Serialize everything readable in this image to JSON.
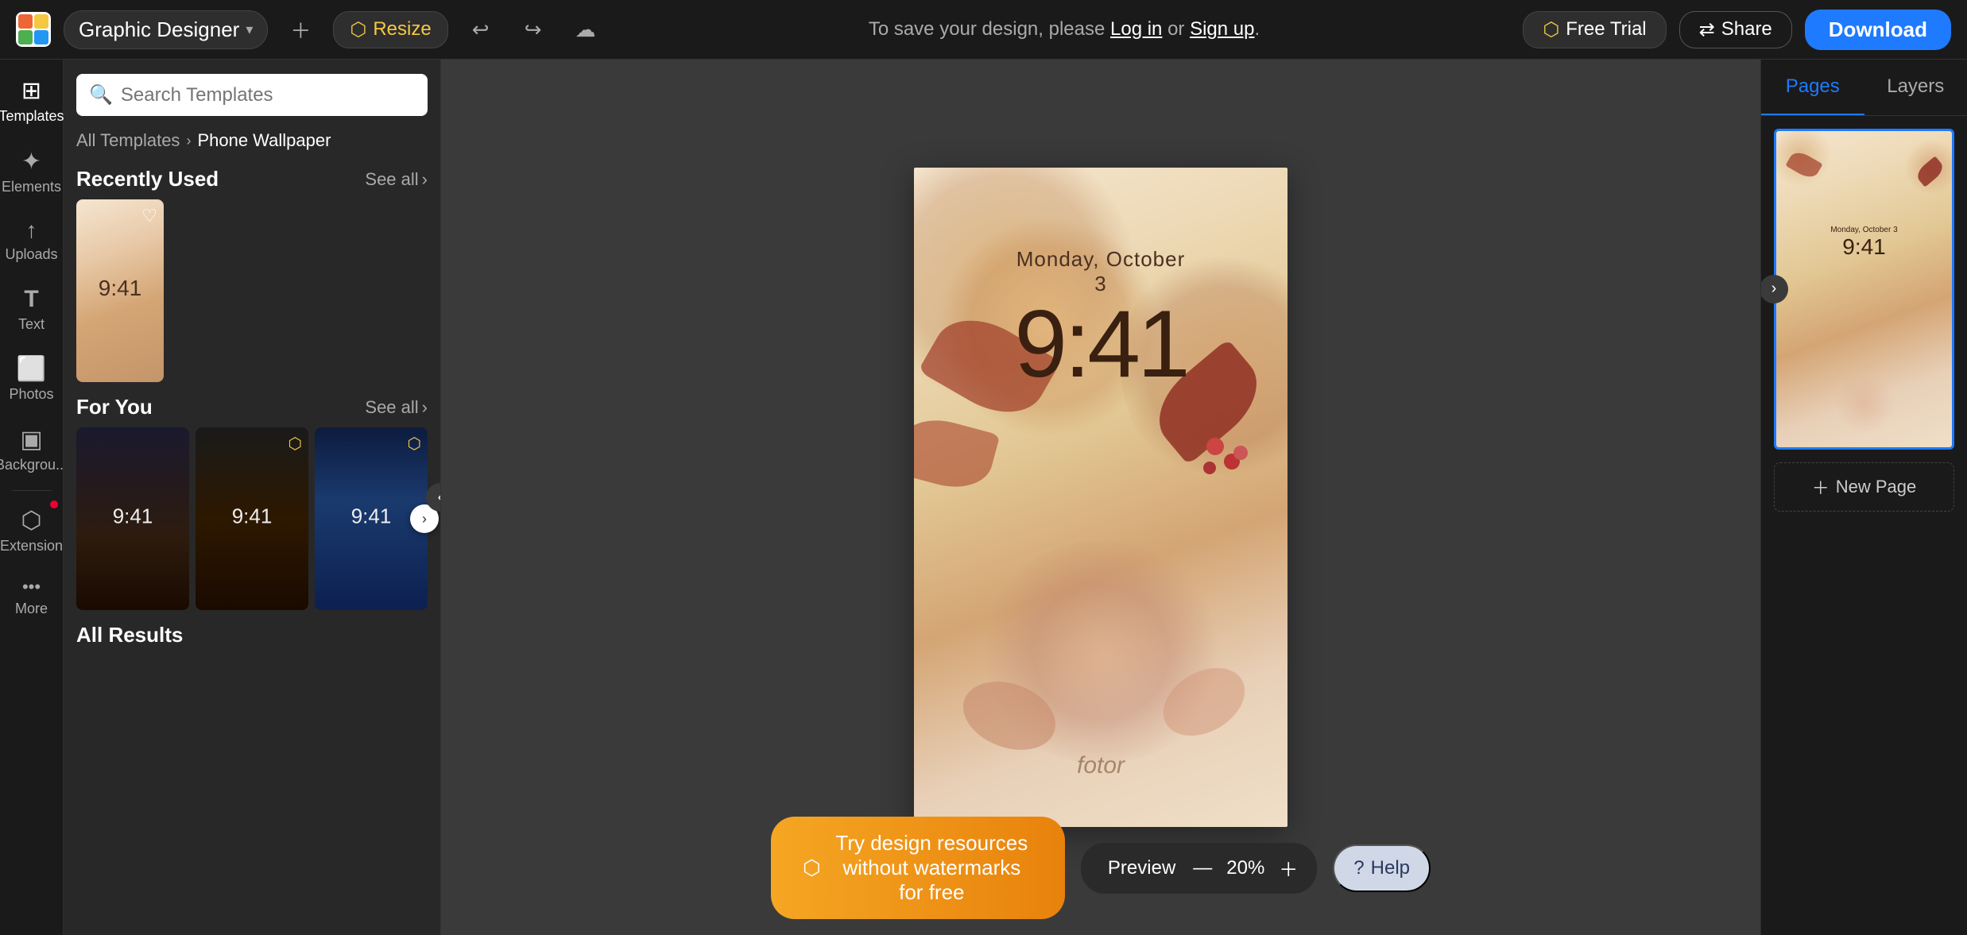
{
  "navbar": {
    "logo_text": "fotor",
    "app_name": "Graphic Designer",
    "resize_label": "Resize",
    "save_message": "To save your design, please",
    "log_in": "Log in",
    "or": "or",
    "sign_up": "Sign up",
    "free_trial_label": "Free Trial",
    "share_label": "Share",
    "download_label": "Download"
  },
  "sidebar": {
    "items": [
      {
        "id": "templates",
        "label": "Templates",
        "icon": "⊞"
      },
      {
        "id": "elements",
        "label": "Elements",
        "icon": "✦"
      },
      {
        "id": "uploads",
        "label": "Uploads",
        "icon": "⬆"
      },
      {
        "id": "text",
        "label": "Text",
        "icon": "T"
      },
      {
        "id": "photos",
        "label": "Photos",
        "icon": "🖼"
      },
      {
        "id": "backgrounds",
        "label": "Backgrou...",
        "icon": "◫"
      },
      {
        "id": "extension",
        "label": "Extension",
        "icon": "⬡"
      },
      {
        "id": "more",
        "label": "More",
        "icon": "•••"
      }
    ]
  },
  "template_panel": {
    "search_placeholder": "Search Templates",
    "breadcrumb_all": "All Templates",
    "breadcrumb_current": "Phone Wallpaper",
    "recently_used_label": "Recently Used",
    "see_all_label": "See all",
    "for_you_label": "For You",
    "all_results_label": "All Results"
  },
  "canvas": {
    "date_text": "Monday, October 3",
    "time_text": "9:41",
    "logo_text": "fotor"
  },
  "bottom_bar": {
    "watermark_text": "Try design resources without watermarks for free",
    "preview_label": "Preview",
    "zoom_level": "20%",
    "help_label": "Help"
  },
  "right_panel": {
    "tab_pages": "Pages",
    "tab_layers": "Layers",
    "new_page_label": "New Page",
    "page_time": "9:41"
  },
  "colors": {
    "accent_blue": "#1e7aff",
    "accent_gold": "#f5c842",
    "background_dark": "#1a1a1a",
    "canvas_bg": "#e8d0b0"
  }
}
